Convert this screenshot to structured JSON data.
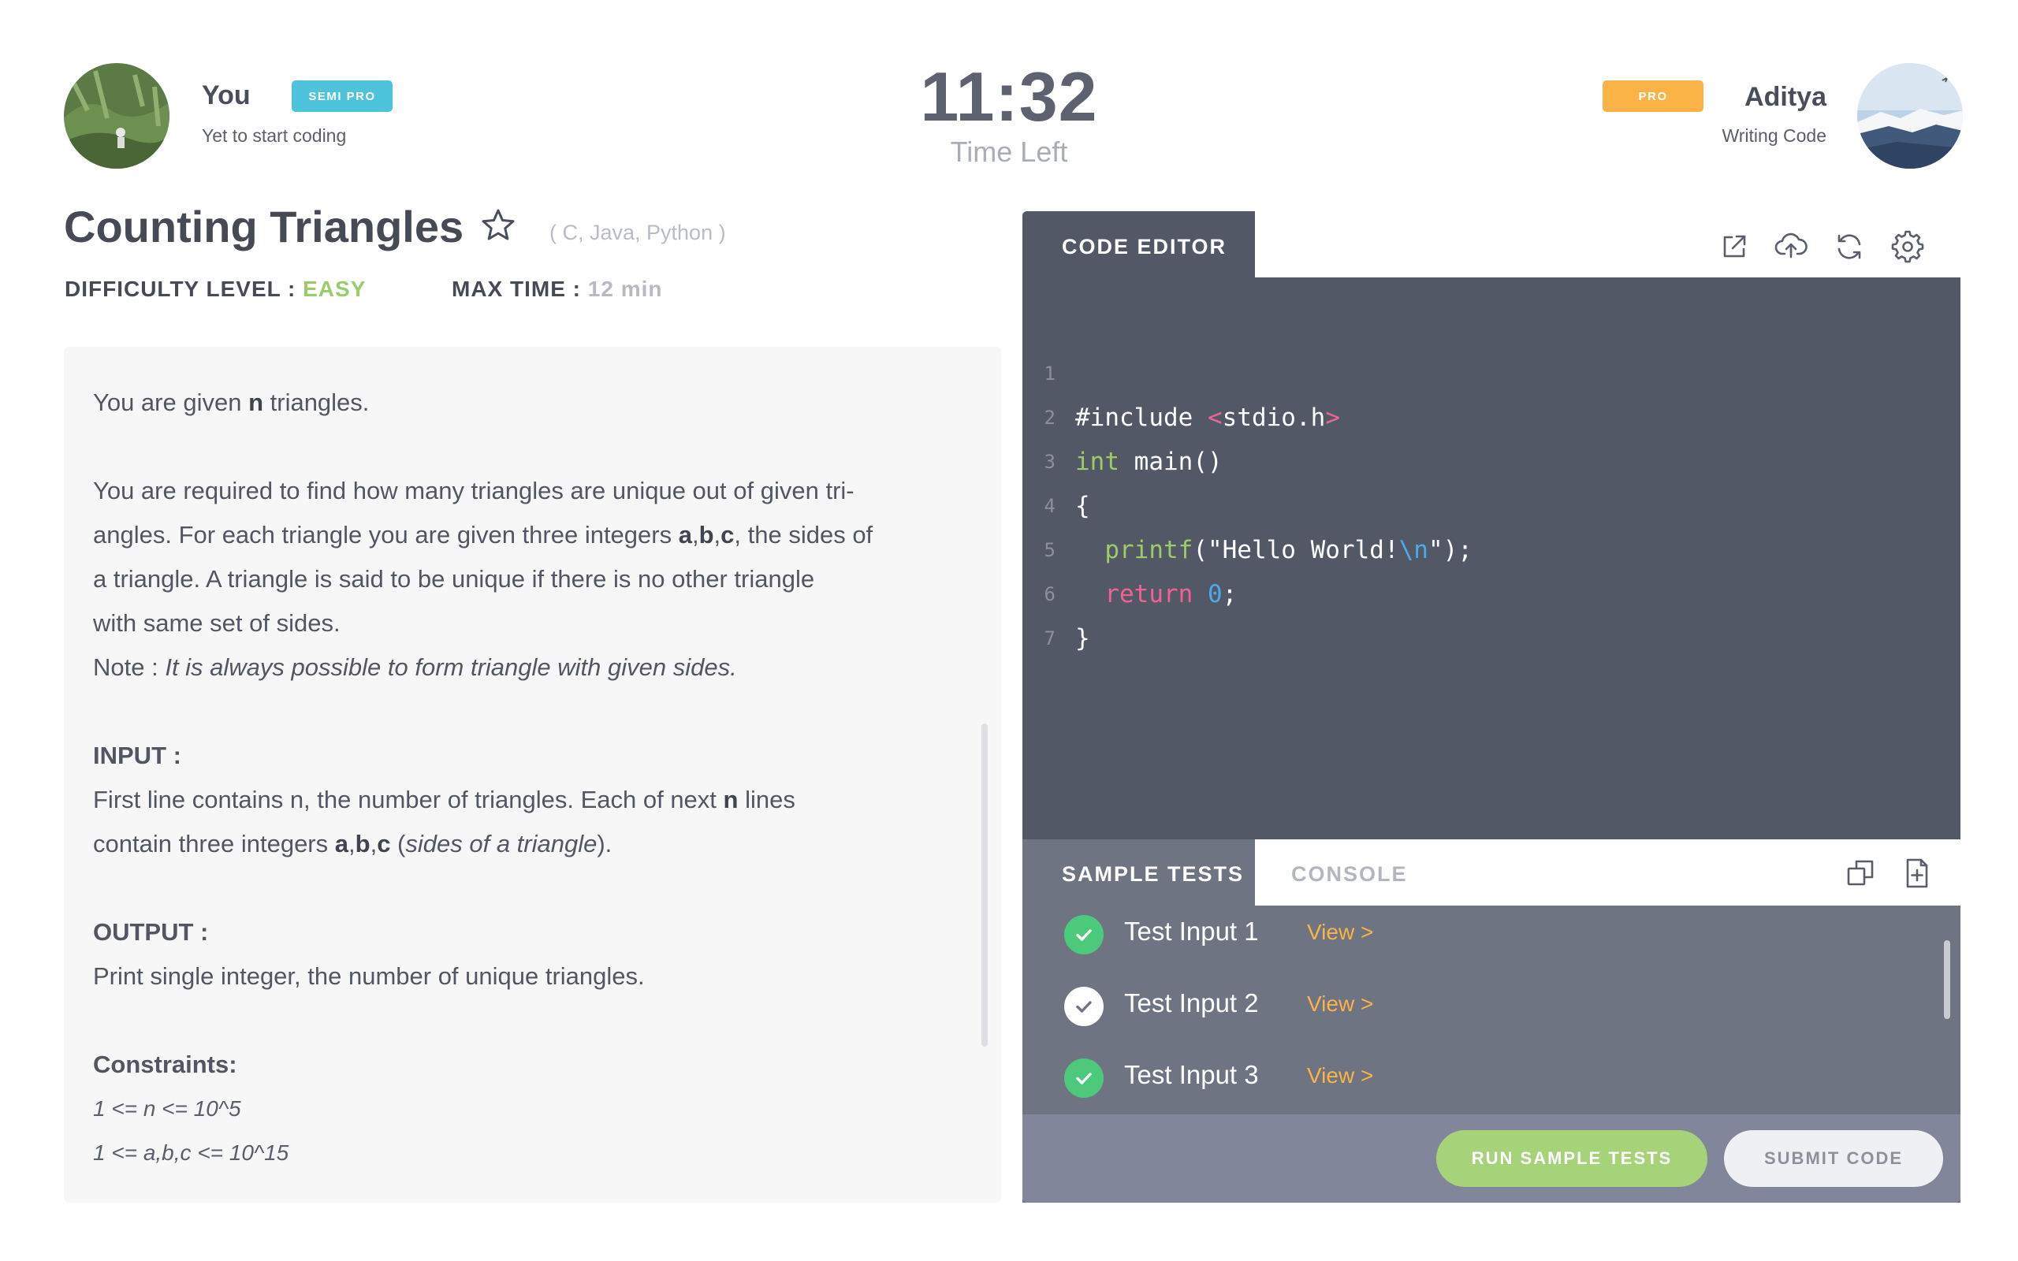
{
  "player_left": {
    "name": "You",
    "badge": "SEMI PRO",
    "status": "Yet to start coding"
  },
  "player_right": {
    "name": "Aditya",
    "badge": "PRO",
    "status": "Writing Code"
  },
  "timer": {
    "value": "11:32",
    "label": "Time Left"
  },
  "problem": {
    "title": "Counting Triangles",
    "languages": "( C, Java, Python )",
    "difficulty_label": "DIFFICULTY LEVEL :",
    "difficulty_value": "EASY",
    "max_time_label": "MAX TIME :",
    "max_time_value": "12 min",
    "intro_1": "You are given ",
    "intro_n": "n",
    "intro_2": " triangles.",
    "para1_a": "You are required to find how many triangles are unique out of given tri-",
    "para1_b": "angles. For each triangle you are given three integers ",
    "para1_abc_a": "a",
    "para1_abc_b": "b",
    "para1_abc_c": "c",
    "para1_c": ", the sides of",
    "para1_d": "a triangle. A triangle is said to be unique if there is no other triangle",
    "para1_e": "with same set of sides.",
    "note_label": "Note : ",
    "note_text": "It is always possible to form triangle with given sides.",
    "input_heading": "INPUT :",
    "input_1a": "First line contains n, the number of triangles. Each of next ",
    "input_1n": "n",
    "input_1b": " lines",
    "input_2a": "contain three integers ",
    "input_2_a": "a",
    "input_2_b": "b",
    "input_2_c": "c",
    "input_2b": " (",
    "input_2i": "sides of a triangle",
    "input_2c": ").",
    "output_heading": "OUTPUT :",
    "output_text": "Print single integer, the number of unique triangles.",
    "constraints_heading": "Constraints:",
    "constraint_1": "1 <= n <= 10^5",
    "constraint_2": "1 <= a,b,c <= 10^15"
  },
  "editor": {
    "tab_label": "CODE EDITOR",
    "icons": [
      "external-link-icon",
      "upload-icon",
      "refresh-icon",
      "settings-icon"
    ],
    "lines": [
      {
        "num": "1",
        "t1": "#include ",
        "t2": "<",
        "t3": "stdio.h",
        "t4": ">"
      },
      {
        "num": "2",
        "t1": "int",
        "t2": " main()"
      },
      {
        "num": "3",
        "t1": "{"
      },
      {
        "num": "4",
        "t1": "  ",
        "t2": "printf",
        "t3": "(\"Hello World!",
        "t4": "\\n",
        "t5": "\");"
      },
      {
        "num": "5",
        "t1": "  ",
        "t2": "return",
        "t3": " 0",
        "t4": ";"
      },
      {
        "num": "6",
        "t1": "}"
      },
      {
        "num": "7"
      }
    ]
  },
  "tests": {
    "tab_label": "SAMPLE TESTS",
    "console_label": "CONSOLE",
    "items": [
      {
        "label": "Test Input 1",
        "view": "View  >",
        "status": "passed"
      },
      {
        "label": "Test Input 2",
        "view": "View  >",
        "status": "pending"
      },
      {
        "label": "Test Input 3",
        "view": "View  >",
        "status": "passed"
      }
    ],
    "run_label": "RUN SAMPLE TESTS",
    "submit_label": "SUBMIT CODE"
  },
  "colors": {
    "easy": "#9ccb6a",
    "semi_pro_badge": "#4dc3dc",
    "pro_badge": "#f9b347",
    "pass": "#4cc97b",
    "run": "#a6d37a"
  }
}
